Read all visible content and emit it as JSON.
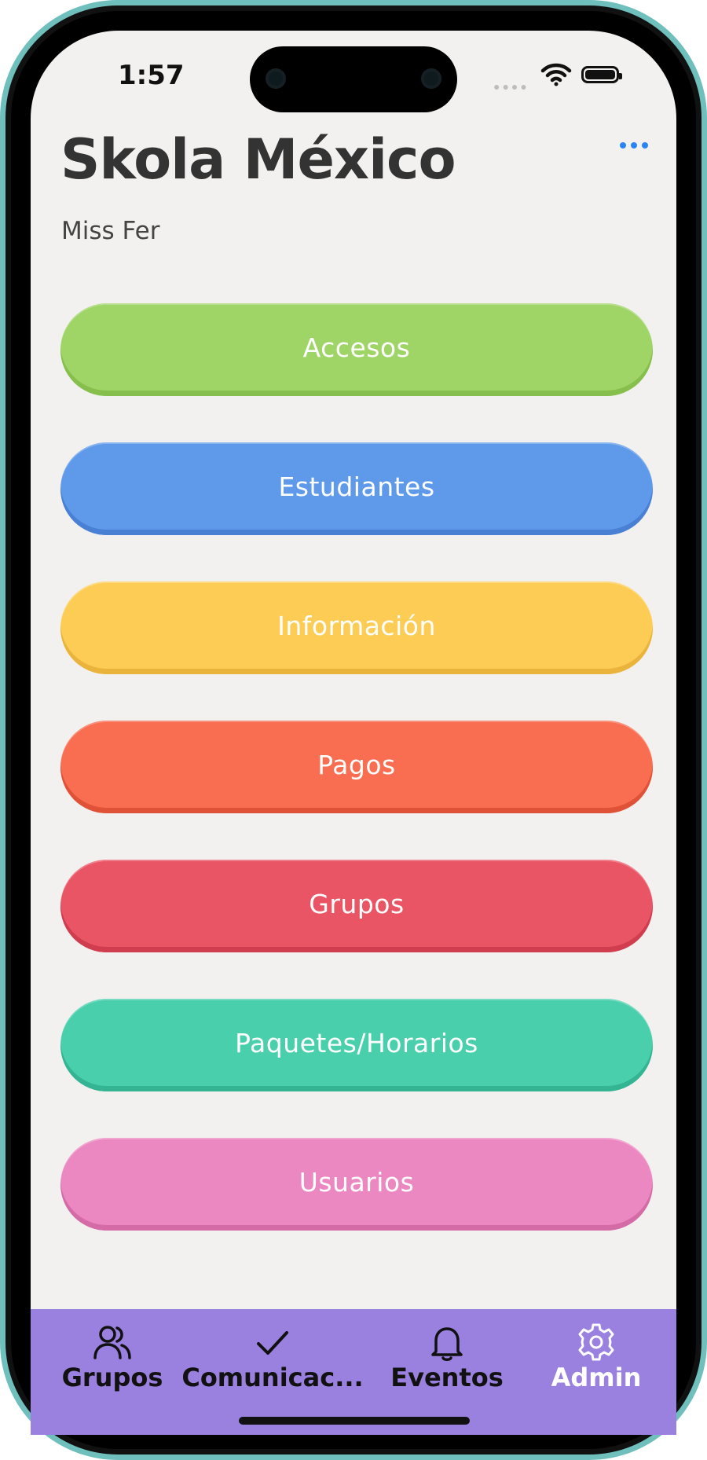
{
  "status_bar": {
    "time": "1:57"
  },
  "header": {
    "title": "Skola México",
    "subtitle": "Miss Fer"
  },
  "menu": [
    {
      "label": "Accesos",
      "color": "#9fd466",
      "shade": "#86bf4c"
    },
    {
      "label": "Estudiantes",
      "color": "#5f9aea",
      "shade": "#4a80d4"
    },
    {
      "label": "Información",
      "color": "#fccc55",
      "shade": "#eab33c"
    },
    {
      "label": "Pagos",
      "color": "#f96d50",
      "shade": "#df5237"
    },
    {
      "label": "Grupos",
      "color": "#ea5565",
      "shade": "#cf3d4e"
    },
    {
      "label": "Paquetes/Horarios",
      "color": "#4acfac",
      "shade": "#34b492"
    },
    {
      "label": "Usuarios",
      "color": "#ec88c1",
      "shade": "#d46ba7"
    }
  ],
  "tabbar": {
    "color": "#9a80df",
    "tabs": [
      {
        "label": "Grupos",
        "icon": "users-icon",
        "active": false
      },
      {
        "label": "Comunicac...",
        "icon": "checkmark-icon",
        "active": false
      },
      {
        "label": "Eventos",
        "icon": "bell-icon",
        "active": false
      },
      {
        "label": "Admin",
        "icon": "gear-icon",
        "active": true
      }
    ]
  }
}
